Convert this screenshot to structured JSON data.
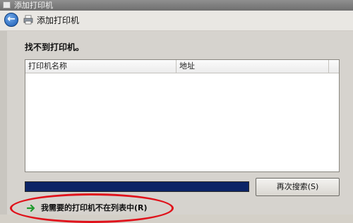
{
  "window": {
    "title": "添加打印机"
  },
  "nav": {
    "title": "添加打印机",
    "back_icon": "back-arrow-icon",
    "printer_icon": "printer-icon"
  },
  "main": {
    "heading": "找不到打印机。",
    "list": {
      "columns": [
        "打印机名称",
        "地址"
      ],
      "rows": []
    },
    "progress_percent": 100,
    "research_button": "再次搜索(S)",
    "not_listed_link": "我需要的打印机不在列表中(R)"
  },
  "colors": {
    "accent": "#0c2466",
    "highlight": "#e0121b"
  }
}
